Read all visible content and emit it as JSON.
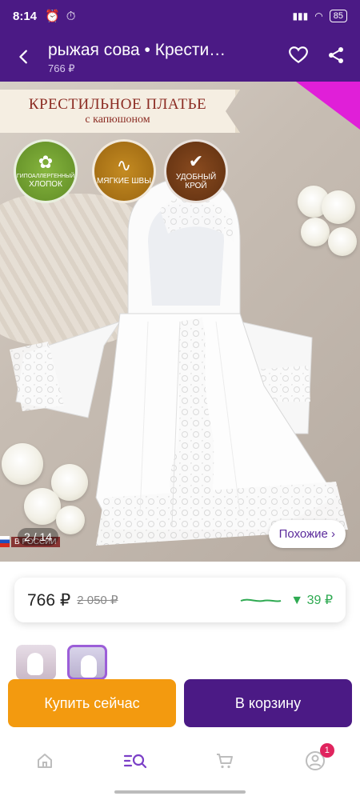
{
  "status": {
    "time": "8:14",
    "battery": "85"
  },
  "app_bar": {
    "title": "рыжая сова • Крести…",
    "subtitle": "766 ₽"
  },
  "hero": {
    "banner_title": "КРЕСТИЛЬНОЕ ПЛАТЬЕ",
    "banner_subtitle": "с капюшоном",
    "badges": [
      {
        "line1": "ГИПОАЛЛЕРГЕННЫЙ",
        "line2": "ХЛОПОК",
        "icon": "cotton-icon"
      },
      {
        "line1": "",
        "line2": "МЯГКИЕ ШВЫ",
        "icon": "stitch-icon"
      },
      {
        "line1": "",
        "line2": "УДОБНЫЙ КРОЙ",
        "icon": "check-icon"
      }
    ],
    "image_counter": "2 / 14",
    "made_in": "В РОССИИ",
    "similar_label": "Похожие ›"
  },
  "price": {
    "current": "766 ₽",
    "old": "2 050 ₽",
    "drop": "▼ 39 ₽",
    "drop_color": "#2faa52"
  },
  "actions": {
    "buy_now": "Купить сейчас",
    "add_to_cart": "В корзину"
  },
  "nav": {
    "profile_badge": "1"
  },
  "colors": {
    "brand": "#4b1a85",
    "buy": "#f39a0f"
  }
}
